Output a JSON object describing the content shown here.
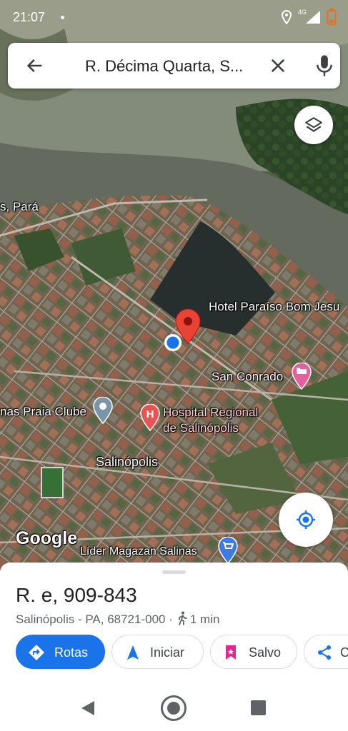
{
  "status_bar": {
    "time": "21:07",
    "network": "4G",
    "icons": [
      "notification-dot-icon",
      "location-icon",
      "signal-4g-icon",
      "battery-low-icon"
    ],
    "battery_color": "#e8711a"
  },
  "search": {
    "query": "R. Décima Quarta, S...",
    "icons": [
      "back-arrow-icon",
      "close-icon",
      "mic-icon"
    ]
  },
  "map": {
    "labels": {
      "state": "s, Pará",
      "hotel": "Hotel Paraíso Bom Jesu",
      "san_conrado": "San Conrado",
      "clube": "nas Praia Clube",
      "hospital_line1": "Hospital Regional",
      "hospital_line2": "de Salinópolis",
      "city": "Salinópolis",
      "lider": "Líder Magazan Salinas",
      "watermark": "Google"
    },
    "colors": {
      "pin": "#ea4335",
      "my_location": "#1a73e8",
      "hotel_poi": "#e2609b",
      "hospital_poi": "#e75454",
      "club_poi": "#7b95a8",
      "shop_poi": "#3d7ae6"
    }
  },
  "controls": {
    "layers_icon": "layers-icon",
    "my_location_icon": "my-location-icon"
  },
  "place": {
    "title": "R. e, 909-843",
    "address": "Salinópolis - PA, 68721-000 ·",
    "walk_time": "1 min"
  },
  "actions": {
    "directions": "Rotas",
    "start": "Iniciar",
    "save": "Salvo",
    "share": "C"
  },
  "accent_color": "#1a73e8",
  "nav_bar": {
    "icons": [
      "back-triangle-icon",
      "home-circle-icon",
      "recents-square-icon"
    ]
  }
}
